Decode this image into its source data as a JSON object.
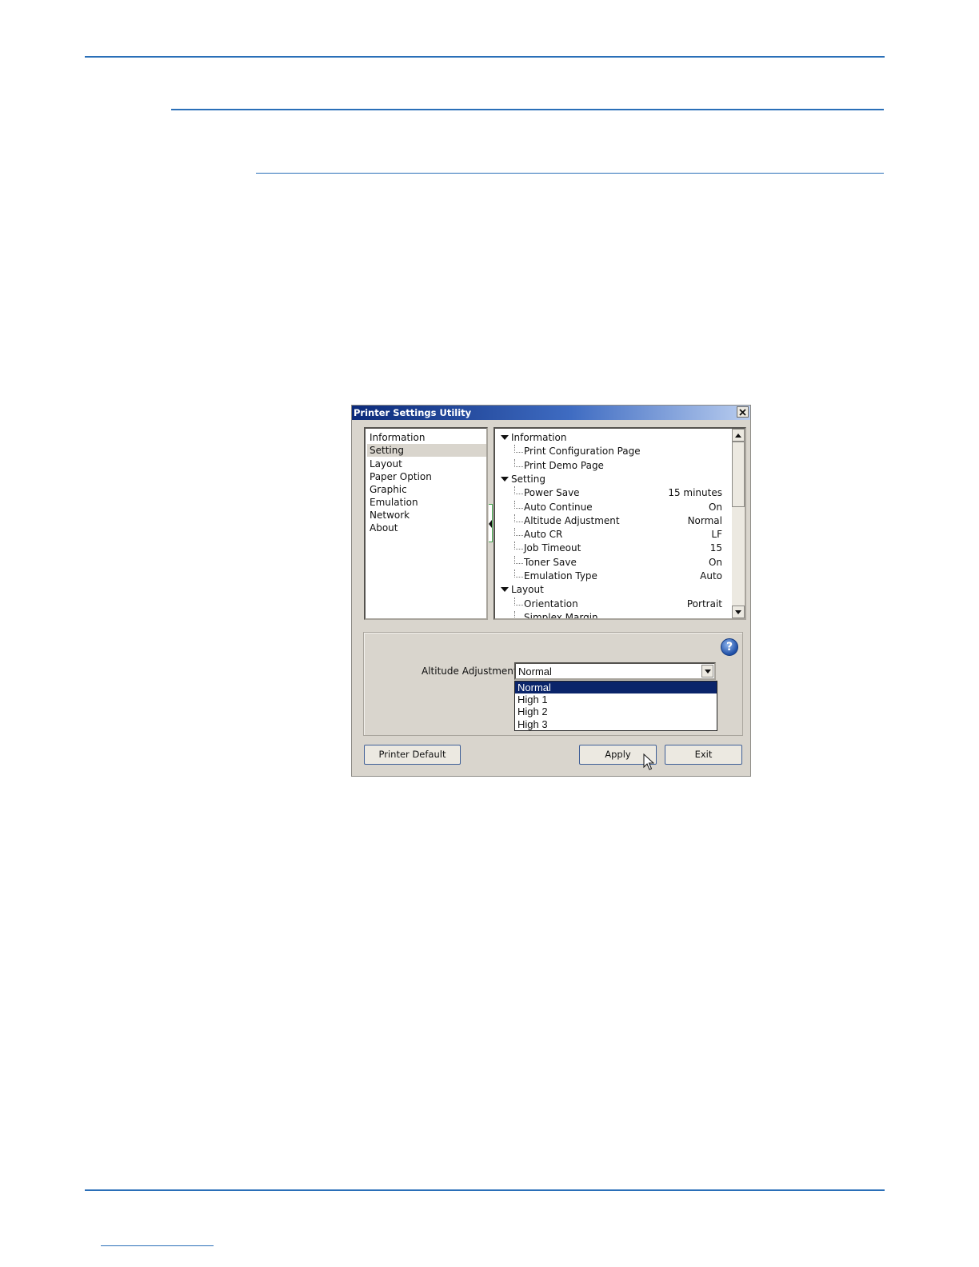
{
  "window": {
    "title": "Printer Settings Utility"
  },
  "nav": {
    "items": [
      "Information",
      "Setting",
      "Layout",
      "Paper Option",
      "Graphic",
      "Emulation",
      "Network",
      "About"
    ],
    "selected": "Setting"
  },
  "tree": {
    "rows": [
      {
        "type": "group",
        "label": "Information",
        "value": ""
      },
      {
        "type": "item",
        "label": "Print Configuration Page",
        "value": ""
      },
      {
        "type": "item",
        "label": "Print Demo Page",
        "value": ""
      },
      {
        "type": "group",
        "label": "Setting",
        "value": ""
      },
      {
        "type": "item",
        "label": "Power Save",
        "value": "15 minutes"
      },
      {
        "type": "item",
        "label": "Auto Continue",
        "value": "On"
      },
      {
        "type": "item",
        "label": "Altitude Adjustment",
        "value": "Normal",
        "highlighted": true
      },
      {
        "type": "item",
        "label": "Auto CR",
        "value": "LF"
      },
      {
        "type": "item",
        "label": "Job Timeout",
        "value": "15"
      },
      {
        "type": "item",
        "label": "Toner Save",
        "value": "On"
      },
      {
        "type": "item",
        "label": "Emulation Type",
        "value": "Auto"
      },
      {
        "type": "group",
        "label": "Layout",
        "value": ""
      },
      {
        "type": "item",
        "label": "Orientation",
        "value": "Portrait"
      },
      {
        "type": "item",
        "label": "Simplex Margin",
        "value": ""
      }
    ]
  },
  "setting": {
    "label": "Altitude Adjustment",
    "current_value": "Normal",
    "options": [
      "Normal",
      "High 1",
      "High 2",
      "High 3"
    ],
    "highlighted_option": "Normal",
    "help_glyph": "?"
  },
  "buttons": {
    "printer_default": "Printer Default",
    "apply": "Apply",
    "exit": "Exit"
  },
  "icons": {
    "close": "close-icon",
    "help": "help-icon",
    "cursor": "mouse-pointer-icon"
  },
  "colors": {
    "rule": "#2a6fb8",
    "selection": "#0a246a",
    "window_bg": "#d9d5cd"
  }
}
